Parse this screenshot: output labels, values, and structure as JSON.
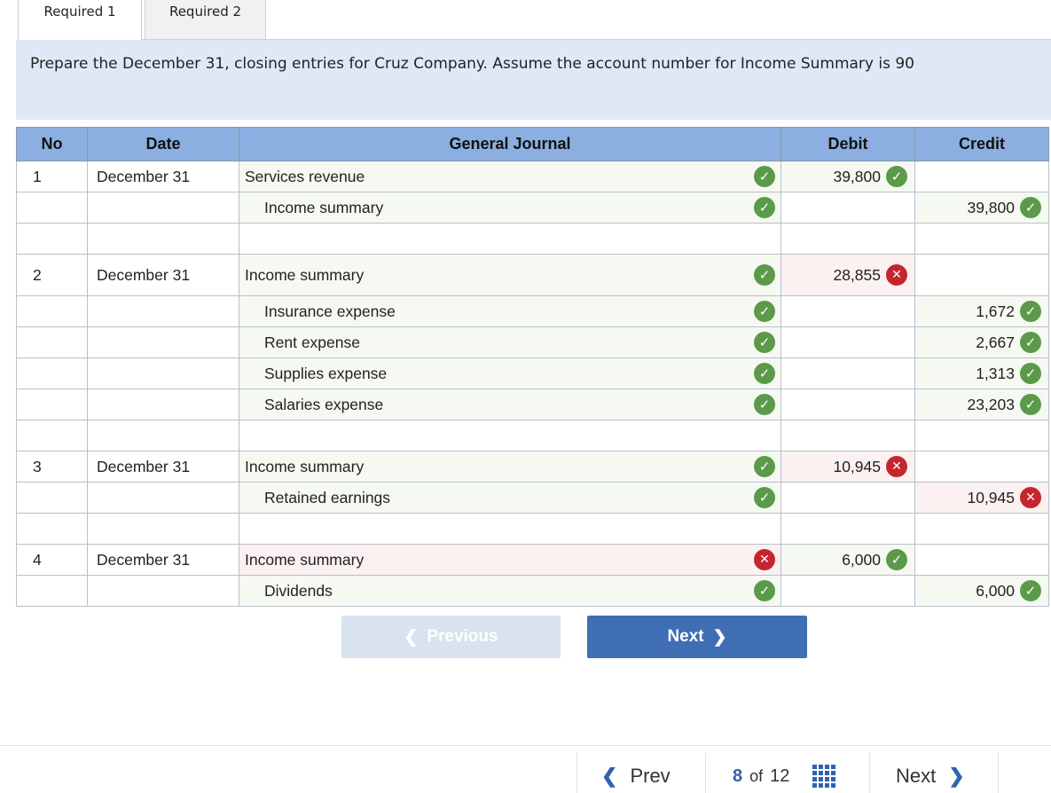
{
  "tabs": [
    {
      "label": "Required 1"
    },
    {
      "label": "Required 2"
    }
  ],
  "instruction": "Prepare the December 31, closing entries for Cruz Company. Assume the account number for Income Summary is 90",
  "table": {
    "headers": {
      "no": "No",
      "date": "Date",
      "journal": "General Journal",
      "debit": "Debit",
      "credit": "Credit"
    },
    "rows": [
      {
        "no": "1",
        "date": "December 31",
        "account": "Services revenue",
        "debit": "39,800",
        "credit": ""
      },
      {
        "no": "",
        "date": "",
        "account": "Income summary",
        "debit": "",
        "credit": "39,800"
      },
      {
        "no": "",
        "date": "",
        "account": "",
        "debit": "",
        "credit": ""
      },
      {
        "no": "2",
        "date": "December 31",
        "account": "Income summary",
        "debit": "28,855",
        "credit": ""
      },
      {
        "no": "",
        "date": "",
        "account": "Insurance expense",
        "debit": "",
        "credit": "1,672"
      },
      {
        "no": "",
        "date": "",
        "account": "Rent expense",
        "debit": "",
        "credit": "2,667"
      },
      {
        "no": "",
        "date": "",
        "account": "Supplies expense",
        "debit": "",
        "credit": "1,313"
      },
      {
        "no": "",
        "date": "",
        "account": "Salaries expense",
        "debit": "",
        "credit": "23,203"
      },
      {
        "no": "",
        "date": "",
        "account": "",
        "debit": "",
        "credit": ""
      },
      {
        "no": "3",
        "date": "December 31",
        "account": "Income summary",
        "debit": "10,945",
        "credit": ""
      },
      {
        "no": "",
        "date": "",
        "account": "Retained earnings",
        "debit": "",
        "credit": "10,945"
      },
      {
        "no": "",
        "date": "",
        "account": "",
        "debit": "",
        "credit": ""
      },
      {
        "no": "4",
        "date": "December 31",
        "account": "Income summary",
        "debit": "6,000",
        "credit": ""
      },
      {
        "no": "",
        "date": "",
        "account": "Dividends",
        "debit": "",
        "credit": "6,000"
      }
    ]
  },
  "buttons": {
    "previous": "Previous",
    "next": "Next"
  },
  "bottom_nav": {
    "prev": "Prev",
    "current": "8",
    "of": "of",
    "total": "12",
    "next": "Next"
  },
  "colors": {
    "correct": "#5b9a4a",
    "incorrect": "#c4262e",
    "header": "#8aafe0",
    "accent": "#3f6eb5"
  },
  "icons": {
    "correct": "check-circle-icon",
    "incorrect": "x-circle-icon"
  }
}
